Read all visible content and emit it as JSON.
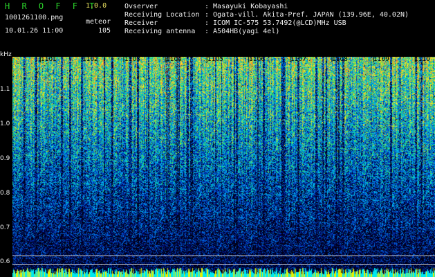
{
  "header": {
    "app_title": "H R O F F T",
    "version": "1.0.0",
    "filename": "1001261100.png",
    "mode": "meteor",
    "datetime": "10.01.26 11:00",
    "count": "105"
  },
  "info": [
    {
      "key": "Ovserver",
      "value": ": Masayuki Kobayashi"
    },
    {
      "key": "Receiving Location",
      "value": ": Ogata-vill. Akita-Pref. JAPAN (139.96E, 40.02N)"
    },
    {
      "key": "Receiver",
      "value": ": ICOM IC-575 53.7492(@LCD)MHz USB"
    },
    {
      "key": "Receiving antenna",
      "value": ": A504HB(yagi 4el)"
    }
  ],
  "axis": {
    "unit": "kHz",
    "y_labels": [
      "1.1",
      "1.0",
      "0.9",
      "0.8",
      "0.7",
      "0.6"
    ],
    "time_labels": [
      "1101",
      "1102",
      "1103",
      "1104",
      "1105",
      "1106",
      "1107",
      "1108",
      "1109",
      "1110"
    ]
  },
  "colors": {
    "title": "#2bd62b",
    "version": "#e8e060",
    "text": "#f0f0f0",
    "background": "#000000"
  }
}
